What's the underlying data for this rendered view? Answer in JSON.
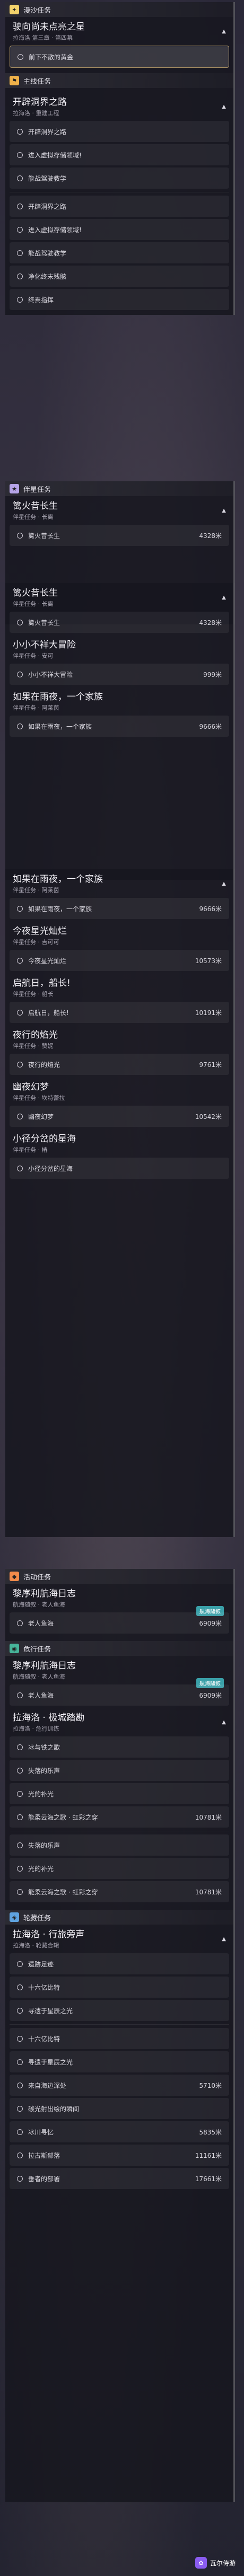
{
  "sections": {
    "dev": {
      "label": "漫沙任务",
      "icon": "sparkle-icon",
      "color": "#f3d26b"
    },
    "main": {
      "label": "主线任务",
      "icon": "flag-icon",
      "color": "#f0b24a"
    },
    "companion": {
      "label": "伴星任务",
      "icon": "star-icon",
      "color": "#b6a4e8"
    },
    "event": {
      "label": "活动任务",
      "icon": "event-icon",
      "color": "#f08a4a"
    },
    "daily": {
      "label": "危行任务",
      "icon": "daily-icon",
      "color": "#47b49a"
    },
    "side": {
      "label": "轮藏任务",
      "icon": "side-icon",
      "color": "#5fa3e0"
    }
  },
  "quests": [
    {
      "title": "驶向尚未点亮之星",
      "subtitle": "拉海洛 第三章 · 第四幕",
      "subs": [
        {
          "label": "前下不散的黄金",
          "distance": "",
          "active": true
        }
      ]
    },
    {
      "title": "开辟洞界之路",
      "subtitle": "拉海洛 · 重建工程",
      "subs": [
        {
          "label": "开辟洞界之路",
          "distance": ""
        },
        {
          "label": "进入虚拟存储领域!",
          "distance": ""
        },
        {
          "label": "能战驾驶教学",
          "distance": ""
        },
        {
          "label": "净化终末残骸",
          "distance": ""
        },
        {
          "label": "终焉指挥",
          "distance": ""
        }
      ]
    },
    {
      "title": "篱火昔长生",
      "subtitle": "伴星任务 · 长离",
      "subs": [
        {
          "label": "篱火昔长生",
          "distance": "4328米"
        }
      ]
    },
    {
      "title": "小小不祥大冒险",
      "subtitle": "伴星任务 · 安可",
      "subs": [
        {
          "label": "小小不祥大冒险",
          "distance": "999米"
        }
      ]
    },
    {
      "title": "如果在雨夜，一个家族",
      "subtitle": "伴星任务 · 阿莱茵",
      "subs": [
        {
          "label": "如果在雨夜，一个家族",
          "distance": "9666米"
        }
      ]
    },
    {
      "title": "今夜星光灿烂",
      "subtitle": "伴星任务 · 吉可可",
      "subs": [
        {
          "label": "今夜星光灿烂",
          "distance": "10573米"
        }
      ]
    },
    {
      "title": "启航日，船长!",
      "subtitle": "伴星任务 · 船长",
      "subs": [
        {
          "label": "启航日，船长!",
          "distance": "10191米"
        }
      ]
    },
    {
      "title": "夜行的焰光",
      "subtitle": "伴星任务 · 赞妮",
      "subs": [
        {
          "label": "夜行的焰光",
          "distance": "9761米"
        }
      ]
    },
    {
      "title": "幽夜幻梦",
      "subtitle": "伴星任务 · 坎特蕾拉",
      "subs": [
        {
          "label": "幽夜幻梦",
          "distance": "10542米"
        }
      ]
    },
    {
      "title": "小径分岔的星海",
      "subtitle": "伴星任务 · 椿",
      "subs": [
        {
          "label": "小径分岔的星海",
          "distance": ""
        }
      ]
    },
    {
      "title": "黎序利航海日志",
      "subtitle": "航海随叙 · 老人鱼海",
      "subs": [
        {
          "label": "老人鱼海",
          "distance": "6909米"
        }
      ]
    },
    {
      "title": "拉海洛 · 极城踏勘",
      "subtitle": "拉海洛 · 危行训练",
      "subs": [
        {
          "label": "冰与铁之歌",
          "distance": ""
        },
        {
          "label": "失落的乐声",
          "distance": ""
        },
        {
          "label": "光的补光",
          "distance": ""
        },
        {
          "label": "能柔云海之歌 · 虹彩之穿",
          "distance": "10781米"
        }
      ]
    },
    {
      "title": "拉海洛 · 行旅旁声",
      "subtitle": "拉海洛 · 轮藏合辑",
      "subs": [
        {
          "label": "遗跡足迹",
          "distance": ""
        },
        {
          "label": "十六亿比特",
          "distance": ""
        },
        {
          "label": "寻遗于星辰之光",
          "distance": ""
        },
        {
          "label": "来自海边深处",
          "distance": "5710米"
        },
        {
          "label": "碳光射出绘的瞬间",
          "distance": ""
        },
        {
          "label": "冰川寻忆",
          "distance": "5835米"
        },
        {
          "label": "拉古斯部落",
          "distance": "11161米"
        },
        {
          "label": "垂者的部署",
          "distance": "17661米"
        }
      ]
    }
  ],
  "tags": {
    "navigation": "航海随叙"
  },
  "brand": {
    "label": "瓦尔侍游"
  }
}
